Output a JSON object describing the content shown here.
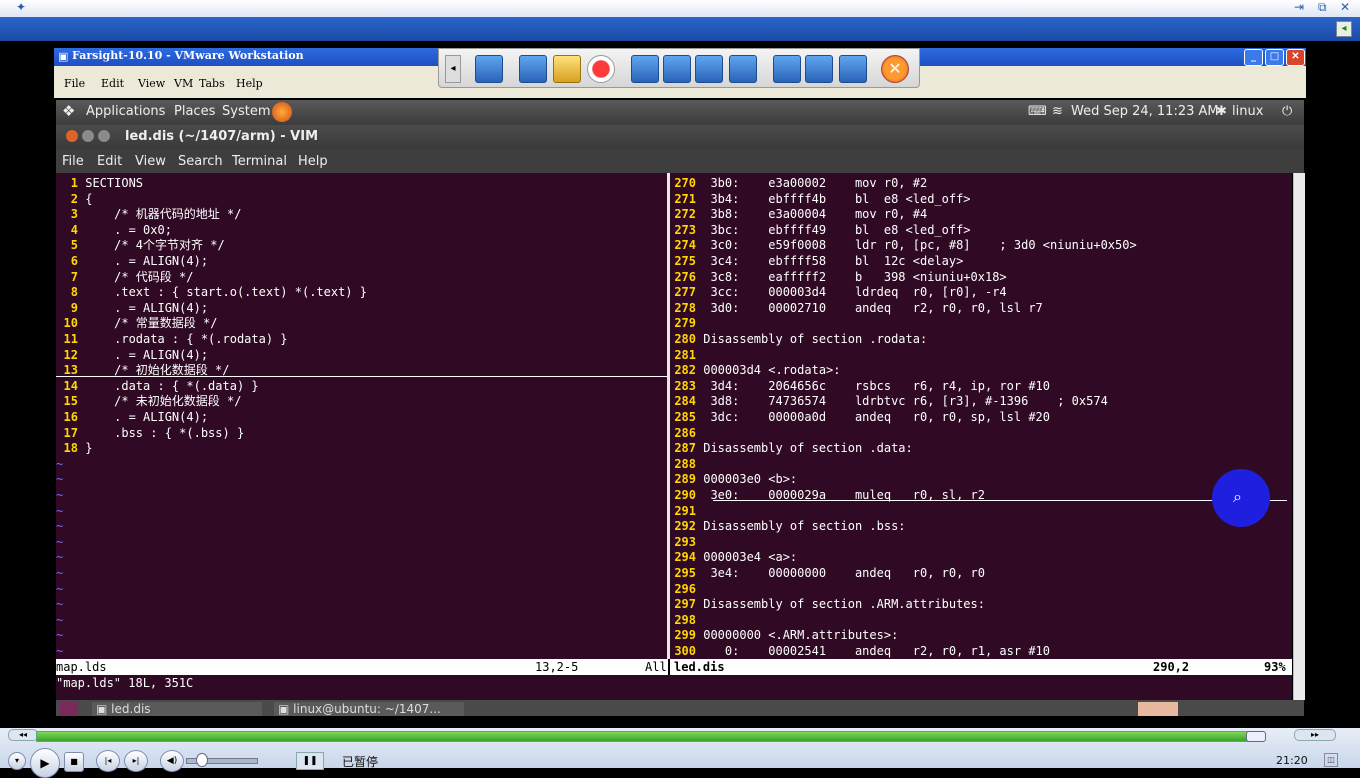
{
  "player": {
    "top_controls": [
      "⇥",
      "⧉",
      "✕"
    ],
    "status_text": "已暂停",
    "time": "21:20"
  },
  "vmware": {
    "title": "Farsight-10.10 - VMware Workstation",
    "menu": [
      "File",
      "Edit",
      "View",
      "VM",
      "Tabs",
      "Help"
    ]
  },
  "gnome_panel": {
    "menu": [
      "Applications",
      "Places",
      "System"
    ],
    "datetime": "Wed Sep 24, 11:23 AM",
    "user": "linux"
  },
  "vim_window": {
    "title": "led.dis (~/1407/arm) - VIM",
    "menu": [
      "File",
      "Edit",
      "View",
      "Search",
      "Terminal",
      "Help"
    ]
  },
  "left_pane": {
    "lines": [
      {
        "n": "1",
        "t": "SECTIONS"
      },
      {
        "n": "2",
        "t": "{"
      },
      {
        "n": "3",
        "t": "    /* 机器代码的地址 */"
      },
      {
        "n": "4",
        "t": "    . = 0x0;"
      },
      {
        "n": "5",
        "t": "    /* 4个字节对齐 */"
      },
      {
        "n": "6",
        "t": "    . = ALIGN(4);"
      },
      {
        "n": "7",
        "t": "    /* 代码段 */"
      },
      {
        "n": "8",
        "t": "    .text : { start.o(.text) *(.text) }"
      },
      {
        "n": "9",
        "t": "    . = ALIGN(4);"
      },
      {
        "n": "10",
        "t": "    /* 常量数据段 */"
      },
      {
        "n": "11",
        "t": "    .rodata : { *(.rodata) }"
      },
      {
        "n": "12",
        "t": "    . = ALIGN(4);"
      },
      {
        "n": "13",
        "t": "    /* 初始化数据段 */"
      },
      {
        "n": "14",
        "t": "    .data : { *(.data) }"
      },
      {
        "n": "15",
        "t": "    /* 未初始化数据段 */"
      },
      {
        "n": "16",
        "t": "    . = ALIGN(4);"
      },
      {
        "n": "17",
        "t": "    .bss : { *(.bss) }"
      },
      {
        "n": "18",
        "t": "}"
      }
    ],
    "tilde": "~",
    "status_file": "map.lds",
    "status_pos": "13,2-5",
    "status_scroll": "All"
  },
  "right_pane": {
    "lines": [
      {
        "n": "270",
        "t": " 3b0:    e3a00002    mov r0, #2"
      },
      {
        "n": "271",
        "t": " 3b4:    ebffff4b    bl  e8 <led_off>"
      },
      {
        "n": "272",
        "t": " 3b8:    e3a00004    mov r0, #4"
      },
      {
        "n": "273",
        "t": " 3bc:    ebffff49    bl  e8 <led_off>"
      },
      {
        "n": "274",
        "t": " 3c0:    e59f0008    ldr r0, [pc, #8]    ; 3d0 <niuniu+0x50>"
      },
      {
        "n": "275",
        "t": " 3c4:    ebffff58    bl  12c <delay>"
      },
      {
        "n": "276",
        "t": " 3c8:    eafffff2    b   398 <niuniu+0x18>"
      },
      {
        "n": "277",
        "t": " 3cc:    000003d4    ldrdeq  r0, [r0], -r4"
      },
      {
        "n": "278",
        "t": " 3d0:    00002710    andeq   r2, r0, r0, lsl r7"
      },
      {
        "n": "279",
        "t": ""
      },
      {
        "n": "280",
        "t": "Disassembly of section .rodata:"
      },
      {
        "n": "281",
        "t": ""
      },
      {
        "n": "282",
        "t": "000003d4 <.rodata>:"
      },
      {
        "n": "283",
        "t": " 3d4:    2064656c    rsbcs   r6, r4, ip, ror #10"
      },
      {
        "n": "284",
        "t": " 3d8:    74736574    ldrbtvc r6, [r3], #-1396    ; 0x574"
      },
      {
        "n": "285",
        "t": " 3dc:    00000a0d    andeq   r0, r0, sp, lsl #20"
      },
      {
        "n": "286",
        "t": ""
      },
      {
        "n": "287",
        "t": "Disassembly of section .data:"
      },
      {
        "n": "288",
        "t": ""
      },
      {
        "n": "289",
        "t": "000003e0 <b>:"
      },
      {
        "n": "290",
        "t": " 3e0:    0000029a    muleq   r0, sl, r2"
      },
      {
        "n": "291",
        "t": ""
      },
      {
        "n": "292",
        "t": "Disassembly of section .bss:"
      },
      {
        "n": "293",
        "t": ""
      },
      {
        "n": "294",
        "t": "000003e4 <a>:"
      },
      {
        "n": "295",
        "t": " 3e4:    00000000    andeq   r0, r0, r0"
      },
      {
        "n": "296",
        "t": ""
      },
      {
        "n": "297",
        "t": "Disassembly of section .ARM.attributes:"
      },
      {
        "n": "298",
        "t": ""
      },
      {
        "n": "299",
        "t": "00000000 <.ARM.attributes>:"
      },
      {
        "n": "300",
        "t": "   0:    00002541    andeq   r2, r0, r1, asr #10"
      }
    ],
    "status_file": "led.dis",
    "status_pos": "290,2",
    "status_scroll": "93%"
  },
  "cmdline": "\"map.lds\" 18L, 351C",
  "taskbar": [
    "led.dis",
    "linux@ubuntu: ~/1407..."
  ]
}
